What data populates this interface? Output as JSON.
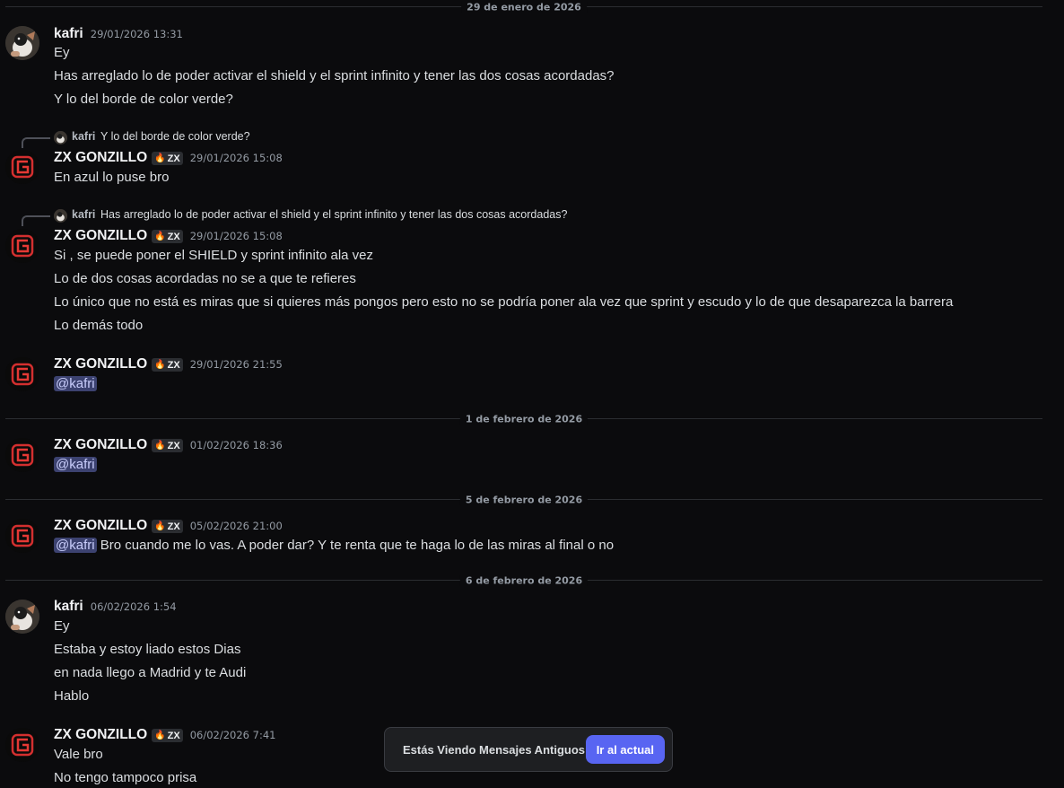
{
  "dividers": [
    "29 de enero de 2026",
    "1 de febrero de 2026",
    "5 de febrero de 2026",
    "6 de febrero de 2026"
  ],
  "badge": "ZX",
  "messages": [
    {
      "author": "kafri",
      "time": "29/01/2026 13:31",
      "lines": [
        "Ey",
        "Has arreglado lo de poder activar el shield y el sprint infinito y tener las dos cosas acordadas?",
        "Y lo del borde de color verde?"
      ]
    },
    {
      "reply": {
        "author": "kafri",
        "text": "Y lo del borde de color verde?"
      },
      "author": "ZX GONZILLO",
      "time": "29/01/2026 15:08",
      "lines": [
        "En azul lo puse bro"
      ]
    },
    {
      "reply": {
        "author": "kafri",
        "text": "Has arreglado lo de poder activar el shield y el sprint infinito y tener las dos cosas acordadas?"
      },
      "author": "ZX GONZILLO",
      "time": "29/01/2026 15:08",
      "lines": [
        "Si , se puede poner el SHIELD y sprint infinito ala vez",
        "Lo de dos cosas acordadas no se a que te refieres",
        "Lo único que no está es miras que si quieres más pongos pero esto no se podría poner ala vez que sprint y escudo y lo de que desaparezca la barrera",
        "Lo demás todo"
      ]
    },
    {
      "author": "ZX GONZILLO",
      "time": "29/01/2026 21:55",
      "mention": "@kafri"
    },
    {
      "author": "ZX GONZILLO",
      "time": "01/02/2026 18:36",
      "mention": "@kafri"
    },
    {
      "author": "ZX GONZILLO",
      "time": "05/02/2026 21:00",
      "mention": "@kafri",
      "after_mention": "Bro cuando me lo vas. A poder dar? Y te renta que te haga lo de las miras al final o no"
    },
    {
      "author": "kafri",
      "time": "06/02/2026 1:54",
      "lines": [
        "Ey",
        "Estaba y estoy liado estos Dias",
        "en nada llego a Madrid y te Audi",
        "Hablo"
      ]
    },
    {
      "author": "ZX GONZILLO",
      "time": "06/02/2026 7:41",
      "lines": [
        "Vale bro",
        "No tengo tampoco prisa"
      ]
    }
  ],
  "toast": {
    "text": "Estás Viendo Mensajes Antiguos",
    "button": "Ir al actual"
  },
  "icons": {
    "badge_icon": "flame-icon",
    "avatar_g": "g-logo-avatar",
    "avatar_kafri": "photo-avatar"
  },
  "colors": {
    "accent": "#5865f2",
    "mention_bg": "#3c4270",
    "background": "#0b0b0d"
  }
}
